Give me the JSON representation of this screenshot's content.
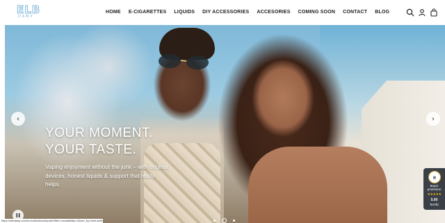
{
  "header": {
    "logo_text": "ELB",
    "logo_sub": "DAMP",
    "nav": [
      {
        "label": "HOME"
      },
      {
        "label": "E-CIGARETTES"
      },
      {
        "label": "LIQUIDS"
      },
      {
        "label": "DIY ACCESSORIES"
      },
      {
        "label": "ACCESORIES"
      },
      {
        "label": "COMING SOON"
      },
      {
        "label": "CONTACT"
      },
      {
        "label": "BLOG"
      }
    ],
    "icons": [
      "search-icon",
      "account-icon",
      "cart-bag-icon"
    ]
  },
  "hero": {
    "title_line1": "YOUR MOMENT.",
    "title_line2": "YOUR TASTE.",
    "subtitle": "Vaping enjoyment without the junk – with original devices, honest liquids & support that really helps.",
    "prev_label": "‹",
    "next_label": "›",
    "slide_count": 3,
    "active_slide": 2
  },
  "trust_badge": {
    "seal": "e",
    "label": "Buyer protection",
    "stars": "★★★★★",
    "score": "5.00",
    "name": "Terrific"
  },
  "status_bar": {
    "url": "https://elbdamp.com/en/collections/liquids?filter.v.availability=1&sort_by=best-selling"
  },
  "colors": {
    "logo_accent": "#7fb6d8",
    "badge_bg": "#3a3f46",
    "star": "#f2b01e"
  }
}
